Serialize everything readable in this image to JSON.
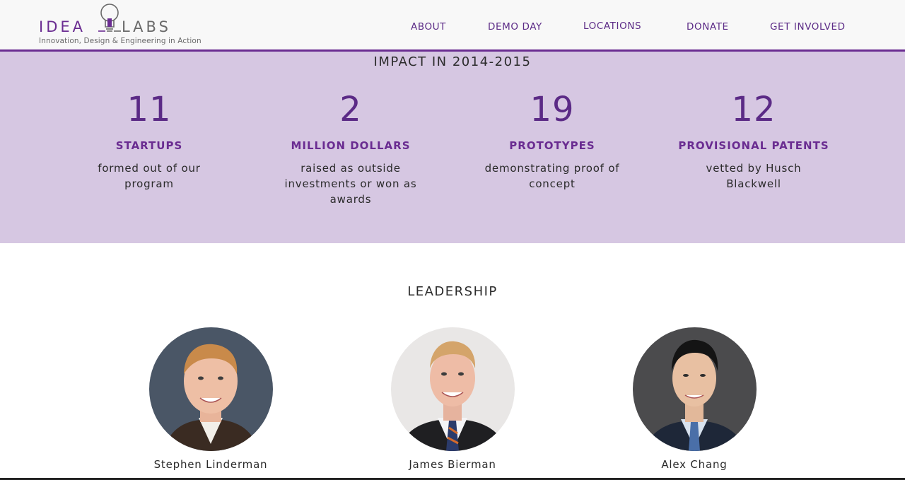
{
  "header": {
    "logo": {
      "word_left": "IDEA",
      "word_right": "LABS",
      "tagline": "Innovation, Design & Engineering in Action",
      "brand_color": "#6a2c91"
    },
    "nav": [
      {
        "label": "ABOUT"
      },
      {
        "label": "DEMO DAY"
      },
      {
        "label": "LOCATIONS"
      },
      {
        "label": "DONATE"
      },
      {
        "label": "GET INVOLVED"
      }
    ]
  },
  "impact": {
    "title": "IMPACT IN 2014-2015",
    "background": "#d6c7e2",
    "stats": [
      {
        "number": "11",
        "label": "STARTUPS",
        "description": "formed out of our program"
      },
      {
        "number": "2",
        "label": "MILLION DOLLARS",
        "description": "raised as outside investments or won as awards"
      },
      {
        "number": "19",
        "label": "PROTOTYPES",
        "description": "demonstrating proof of concept"
      },
      {
        "number": "12",
        "label": "PROVISIONAL PATENTS",
        "description": "vetted by Husch Blackwell"
      }
    ]
  },
  "leadership": {
    "title": "LEADERSHIP",
    "people": [
      {
        "name": "Stephen Linderman"
      },
      {
        "name": "James Bierman"
      },
      {
        "name": "Alex Chang"
      }
    ]
  }
}
